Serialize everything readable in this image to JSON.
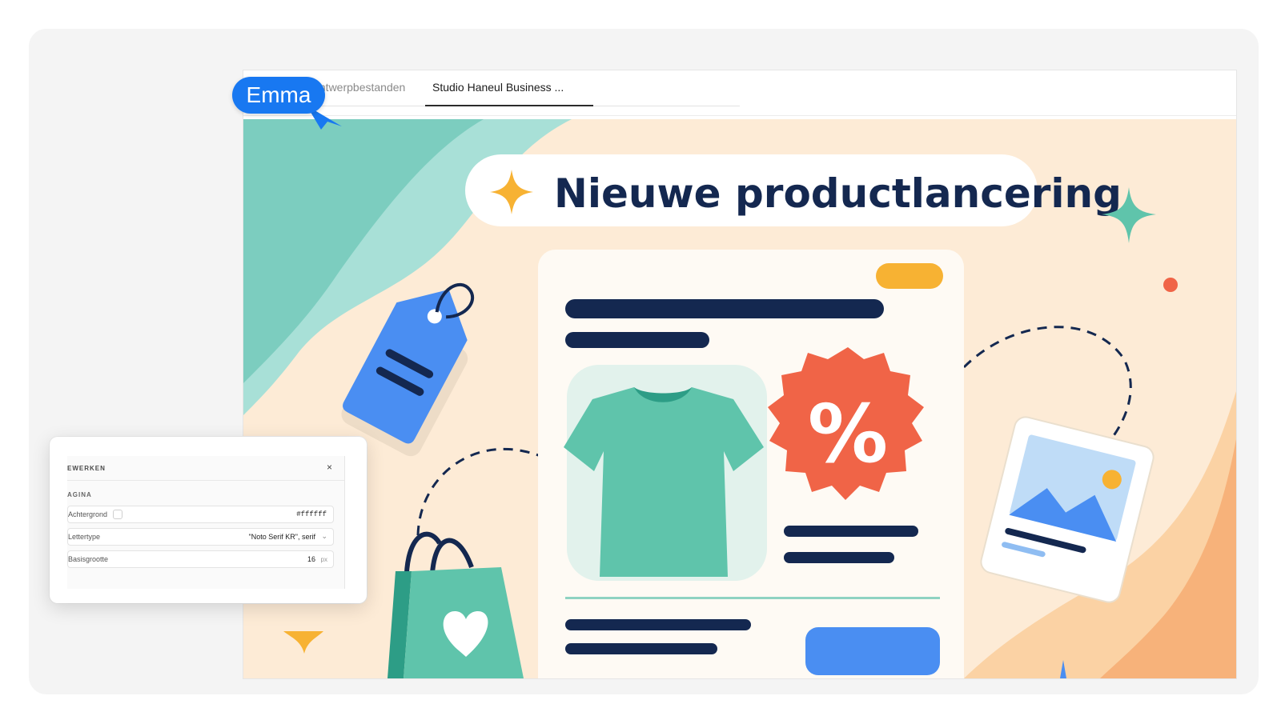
{
  "cursor": {
    "user": "Emma",
    "color": "#1878f1"
  },
  "tabs": {
    "files_label": "Ontwerpbestanden",
    "active_label": "Studio Haneul Business ..."
  },
  "canvas": {
    "headline": "Nieuwe productlancering",
    "discount_symbol": "%"
  },
  "properties": {
    "title": "EWERKEN",
    "close": "×",
    "section": "AGINA",
    "rows": [
      {
        "label": "Achtergrond",
        "value": "#ffffff"
      },
      {
        "label": "Lettertype",
        "value": "\"Noto Serif KR\", serif",
        "chevron": "⌄"
      },
      {
        "label": "Basisgrootte",
        "value": "16",
        "unit": "px"
      }
    ]
  },
  "colors": {
    "navy": "#142850",
    "mint": "#5fc4ab",
    "coral": "#f06447",
    "peach": "#fdebd6",
    "blue": "#4a8ef2",
    "yellow": "#f7b233"
  }
}
